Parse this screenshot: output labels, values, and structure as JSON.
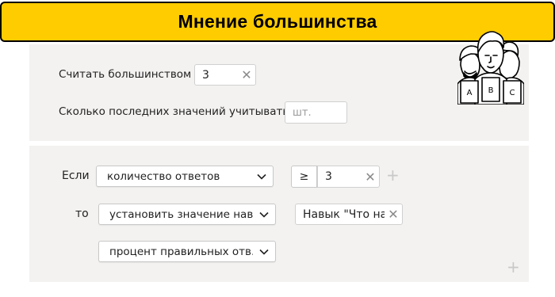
{
  "header": {
    "title": "Мнение большинства"
  },
  "settings": {
    "majority_label": "Считать большинством",
    "majority_value": "3",
    "last_values_label": "Сколько последних значений учитывать",
    "last_values_placeholder": "шт."
  },
  "rule": {
    "if_label": "Если",
    "condition_select": "количество ответов",
    "operator": "≥",
    "threshold_value": "3",
    "then_label": "то",
    "action_select": "установить значение нав...",
    "skill_value": "Навык \"Что на",
    "param_select": "процент правильных отв..."
  },
  "illustration": {
    "cards": [
      "A",
      "B",
      "C"
    ]
  },
  "colors": {
    "header": "#ffcc00",
    "panel": "#f3f2f0",
    "plus": "#c8c8c8"
  }
}
